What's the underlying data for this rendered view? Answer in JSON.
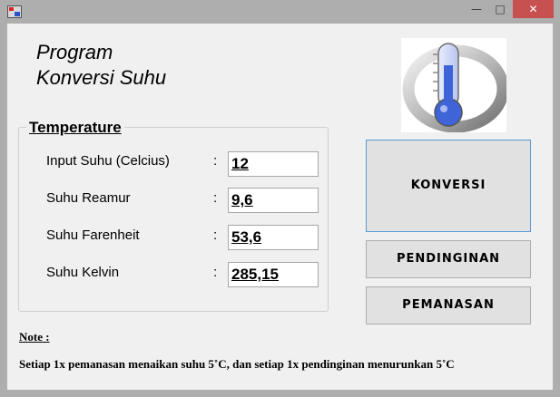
{
  "window": {
    "minimize_glyph": "—",
    "maximize_glyph": "□",
    "close_glyph": "✕"
  },
  "title": {
    "line1": "Program",
    "line2": "Konversi Suhu"
  },
  "thermometer_icon": "thermometer-icon",
  "group": {
    "legend": "Temperature",
    "rows": [
      {
        "label": "Input Suhu (Celcius)",
        "colon": ":",
        "value": "12"
      },
      {
        "label": "Suhu Reamur",
        "colon": ":",
        "value": "9,6"
      },
      {
        "label": "Suhu Farenheit",
        "colon": ":",
        "value": "53,6"
      },
      {
        "label": "Suhu Kelvin",
        "colon": ":",
        "value": "285,15"
      }
    ]
  },
  "buttons": {
    "konversi": "KONVERSI",
    "pendinginan": "PENDINGINAN",
    "pemanasan": "PEMANASAN"
  },
  "note": {
    "label": "Note  :",
    "text": "Setiap 1x pemanasan menaikan suhu 5˚C, dan setiap 1x pendinginan menurunkan 5˚C"
  },
  "colors": {
    "accent_border": "#5a9ad9",
    "close_button": "#c75050",
    "thermometer_blue": "#3e64d8"
  }
}
